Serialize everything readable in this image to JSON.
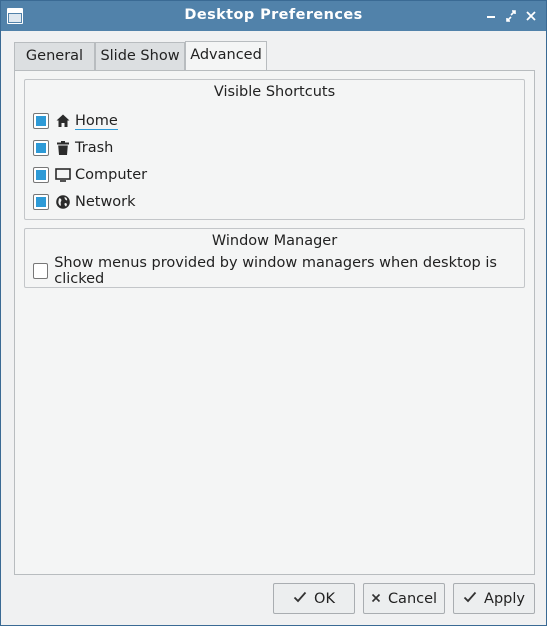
{
  "window": {
    "title": "Desktop Preferences"
  },
  "tabs": [
    {
      "label": "General"
    },
    {
      "label": "Slide Show"
    },
    {
      "label": "Advanced"
    }
  ],
  "active_tab": "Advanced",
  "visible_shortcuts": {
    "title": "Visible Shortcuts",
    "items": [
      {
        "label": "Home",
        "icon": "home-icon",
        "checked": true
      },
      {
        "label": "Trash",
        "icon": "trash-icon",
        "checked": true
      },
      {
        "label": "Computer",
        "icon": "computer-icon",
        "checked": true
      },
      {
        "label": "Network",
        "icon": "globe-icon",
        "checked": true
      }
    ]
  },
  "window_manager": {
    "title": "Window Manager",
    "option_label": "Show menus provided by window managers when desktop is clicked",
    "checked": false
  },
  "buttons": {
    "ok": "OK",
    "cancel": "Cancel",
    "apply": "Apply"
  },
  "colors": {
    "titlebar": "#5182aa",
    "accent": "#2e9ad6"
  }
}
